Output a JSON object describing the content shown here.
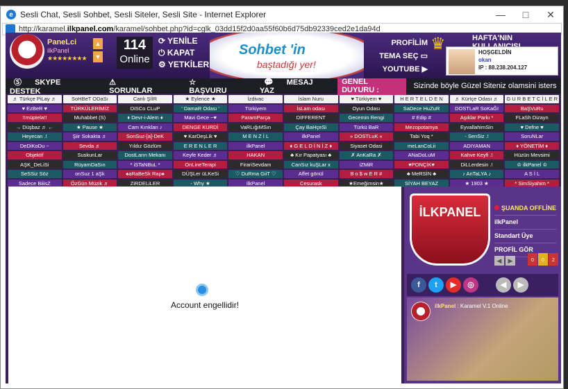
{
  "window": {
    "title": "Sesli Chat, Sesli Sohbet, Sesli Siteler, Sesli Site - Internet Explorer",
    "url_pre": "http://karamel.",
    "url_host": "ilkpanel.com",
    "url_rest": "/karamel/sohbet.php?id=cglk_03dd15f2d0aa55f60b6d75db92339ced2e1da94d",
    "min": "—",
    "max": "□",
    "close": "✕"
  },
  "header": {
    "user_name": "PaneLci",
    "user_sub": "ilkPanel",
    "stars": "★★★★★★★★",
    "online_count": "114",
    "online_label": "Online",
    "menu_left": [
      "YENİLE",
      "KAPAT",
      "YETKİLERİM"
    ],
    "banner_title": "Sohbet 'in",
    "banner_sub": "baştadığı yer!",
    "menu_right": [
      "PROFİLİM",
      "TEMA SEÇ",
      "YOUTUBE"
    ],
    "hafta_title": "HAFTA'NIN KULLANICISI",
    "hosgeldin": "HOŞGELDİN",
    "hafta_user": "okan",
    "ip": "IP : 88.238.204.127"
  },
  "bar": {
    "skype": "SKYPE DESTEK",
    "sorunlar": "SORUNLAR",
    "basvuru": "BAŞVURU",
    "mesaj": "MESAJ YAZ",
    "duyuru": "GENEL DUYURU :",
    "marquee": "Sizinde böyle Güzel Siteniz olamsini isters"
  },
  "rooms": [
    [
      "♬ Türkçe PiLay ♬",
      "SoHBeT ODaSı",
      "Canlı ŞİİR",
      "★ Eylence ★",
      "İzdivac",
      "İslam Nuru",
      "♥ Türkiyem ♥",
      "H E R T E L D E N",
      "♬ Kürtçe Odası ♬",
      "G U R B E T C İ L E R"
    ],
    [
      "♥ EzBeR ♥",
      "TÜRKÜLERİMİZ",
      "DiSCo CLuP",
      "' DamaR Odası '",
      "Türkiyem",
      "İsLam odası",
      "Oyun Odası",
      "SaDece HuZuR",
      "DOSTLaR SoKaĞI",
      "BaŞVuRu"
    ],
    [
      "!!müptela!!",
      "Muhabbet (S)",
      "♦ Devr-i-Alem ♦",
      "Mavi Gece ~♥",
      "ParamParça",
      "DİFFERENT",
      "Gecemin Rengi",
      "# Edip #",
      "Aşıklar Parkı *",
      "FLaSh Dizayn"
    ],
    [
      "→ Düşbaz ♬ ←",
      "★ Pause ★",
      "Cam Kırıkları ♪",
      "DENGE KURDİ",
      "VaRLığıMSın",
      "Çay BaHçeSi",
      "Türkü BaR",
      "Mezopotamya",
      "EyvallahimSin",
      "♥ Defne ♥"
    ],
    [
      "Heyecan .!",
      "Şiir Sokakta ♬",
      "SonSuz-[a]-DeK",
      "♥ KarDeşLik ♥",
      "M E N Z İ L",
      "ilkPanel",
      "» DOSTLuK «",
      "Tabi Yoq *",
      "- SenSiz .!",
      "SoruNLar"
    ],
    [
      "DeDiKoDu ~",
      "Sevda ♬",
      "Yıldız Gözlüm",
      "E R E N L E R",
      "ilkPanel",
      "♦ G E L D İ N İ Z ♦",
      "Siyaset Odasi",
      "meLanCoLii",
      "ADIYAMAN",
      "♦ YÖNETİM ♦"
    ],
    [
      "Objektif",
      "SuskunLar",
      "DostLarın Mekanı",
      "Keyfe Keder ♬",
      "HAKAN",
      "♣ Kır Papatyası ♣",
      "✗ AnKaRa ✗",
      "ANaDoLuM",
      "Kahve Keyfi .!",
      "Hüzün Mevsimi"
    ],
    [
      "AŞK_DeLiSi",
      "RüyamDaSın",
      "* iSTaNBuL *",
      "OnLineTerapi",
      "FirariSevdam",
      "CanSız kuŞLar x",
      "iZMiR",
      "♥PONÇİK♥",
      "DiLLerdesin .!",
      "♔ ilkPanel ♔"
    ],
    [
      "SeSSiz Söz",
      "onSuz 1 aŞk",
      "♠aRaBeSk Rap♠",
      "DÜŞLer üLKeSi",
      "♡ DuRma GiiT ♡",
      "Affet gönül",
      "B o $ w E R #",
      "♣ MeRSİN ♣",
      "♪ AnTaLYA ♪",
      "A S İ L"
    ],
    [
      "Sadece BiiisZ",
      "ÖzGün Müzik ♬",
      "ZiRDELiLER",
      "- Why ★",
      "ilkPanel",
      "Cesurask",
      "★Emeğimsin★",
      "SİYAH BEYAZ",
      "★ 1903 ★",
      "* SimSiyahim *"
    ]
  ],
  "main": {
    "message": "Account engellidir!"
  },
  "profile": {
    "logo_text": "İLKPANEL",
    "status": "ŞUANDA OFFLİNE",
    "name": "ilkPanel",
    "rank": "Standart Üye",
    "link": "PROFİL GÖR",
    "badges": [
      "0",
      "0",
      "2"
    ]
  },
  "social": {
    "icons": [
      "f",
      "t",
      "▶",
      "◎"
    ]
  },
  "feed": {
    "name": "ilkPanel",
    "text": ": Karamel V.1 Online"
  }
}
